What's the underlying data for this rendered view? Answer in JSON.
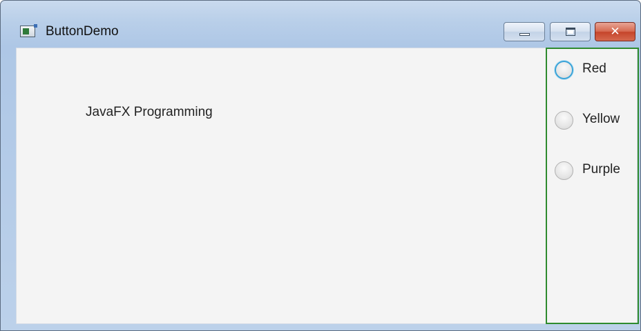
{
  "window": {
    "title": "ButtonDemo",
    "controls": {
      "minimize": "minimize-icon",
      "maximize": "maximize-icon",
      "close": "close-icon"
    }
  },
  "main": {
    "label": "JavaFX Programming"
  },
  "radio_group": {
    "options": [
      {
        "label": "Red",
        "selected": false,
        "focused": true
      },
      {
        "label": "Yellow",
        "selected": false,
        "focused": false
      },
      {
        "label": "Purple",
        "selected": false,
        "focused": false
      }
    ],
    "border_color": "#2e8b2e",
    "focus_color": "#39a3d8"
  }
}
